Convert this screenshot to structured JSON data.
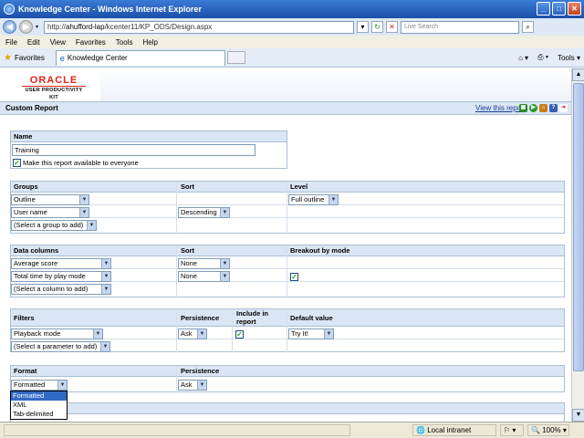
{
  "window": {
    "title": "Knowledge Center - Windows Internet Explorer"
  },
  "address": {
    "url_prefix": "http://",
    "url_host": "ahufford-lap",
    "url_path": "/kcenter11/KP_ODS/Design.aspx",
    "search_placeholder": "Live Search"
  },
  "menu": [
    "File",
    "Edit",
    "View",
    "Favorites",
    "Tools",
    "Help"
  ],
  "favorites": {
    "label": "Favorites",
    "tab_title": "Knowledge Center",
    "tools_label": "Tools"
  },
  "logo": {
    "brand": "ORACLE",
    "product": "USER PRODUCTIVITY KIT"
  },
  "report": {
    "title": "Custom Report",
    "view_link": "View this report"
  },
  "name_section": {
    "header": "Name",
    "value": "Training",
    "checkbox_label": "Make this report available to everyone"
  },
  "groups_section": {
    "headers": [
      "Groups",
      "Sort",
      "Level"
    ],
    "rows": [
      {
        "group": "Outline",
        "sort": "",
        "level": "Full outline"
      },
      {
        "group": "User name",
        "sort": "Descending",
        "level": ""
      },
      {
        "group": "(Select a group to add)",
        "sort": "",
        "level": ""
      }
    ]
  },
  "data_section": {
    "headers": [
      "Data columns",
      "Sort",
      "Breakout by mode"
    ],
    "rows": [
      {
        "column": "Average score",
        "sort": "None"
      },
      {
        "column": "Total time by play mode",
        "sort": "None"
      },
      {
        "column": "(Select a column to add)",
        "sort": ""
      }
    ]
  },
  "filters_section": {
    "headers": [
      "Filters",
      "Persistence",
      "Include in report",
      "Default value"
    ],
    "rows": [
      {
        "filter": "Playback mode",
        "persistence": "Ask",
        "default": "Try It!"
      },
      {
        "filter": "(Select a parameter to add)"
      }
    ]
  },
  "format_section": {
    "headers": [
      "Format",
      "Persistence"
    ],
    "value": "Formatted",
    "persistence": "Ask",
    "options": [
      "Formatted",
      "XML",
      "Tab-delimited"
    ]
  },
  "status": {
    "zone": "Local intranet",
    "zoom": "100%"
  }
}
